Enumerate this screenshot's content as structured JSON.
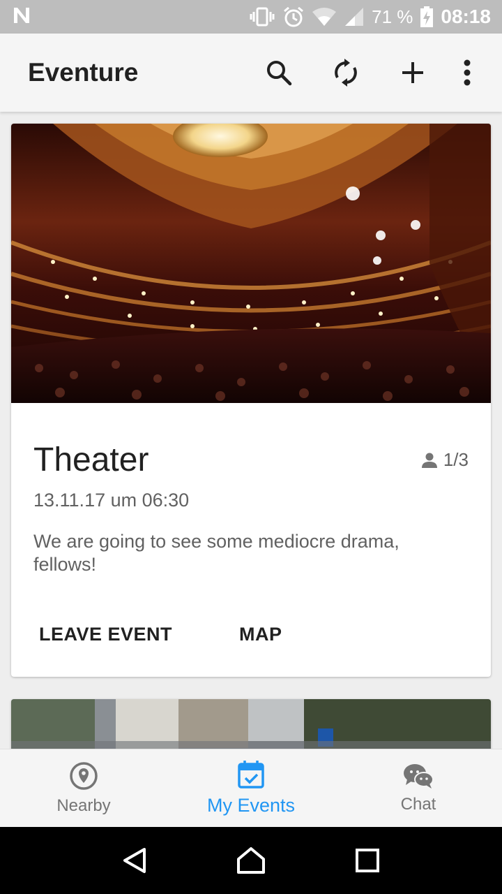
{
  "status_bar": {
    "battery": "71 %",
    "time": "08:18",
    "icons": [
      "n-logo-icon",
      "vibrate-icon",
      "alarm-icon",
      "wifi-icon",
      "signal-icon",
      "battery-charging-icon"
    ]
  },
  "app_bar": {
    "title": "Eventure",
    "actions": [
      "search-icon",
      "sync-icon",
      "add-icon",
      "more-vert-icon"
    ]
  },
  "events": [
    {
      "title": "Theater",
      "attendees": "1/3",
      "date": "13.11.17 um 06:30",
      "description": "We are going to see some mediocre drama, fellows!",
      "actions": {
        "leave": "LEAVE EVENT",
        "map": "MAP"
      }
    }
  ],
  "bottom_nav": {
    "items": [
      {
        "label": "Nearby",
        "icon": "location-pin-icon",
        "active": false
      },
      {
        "label": "My Events",
        "icon": "calendar-check-icon",
        "active": true
      },
      {
        "label": "Chat",
        "icon": "chat-bubbles-icon",
        "active": false
      }
    ]
  },
  "colors": {
    "accent": "#2196f3",
    "status_bar": "#bdbdbd",
    "app_bar": "#f5f5f5",
    "text_primary": "#212121",
    "text_secondary": "#616161"
  }
}
